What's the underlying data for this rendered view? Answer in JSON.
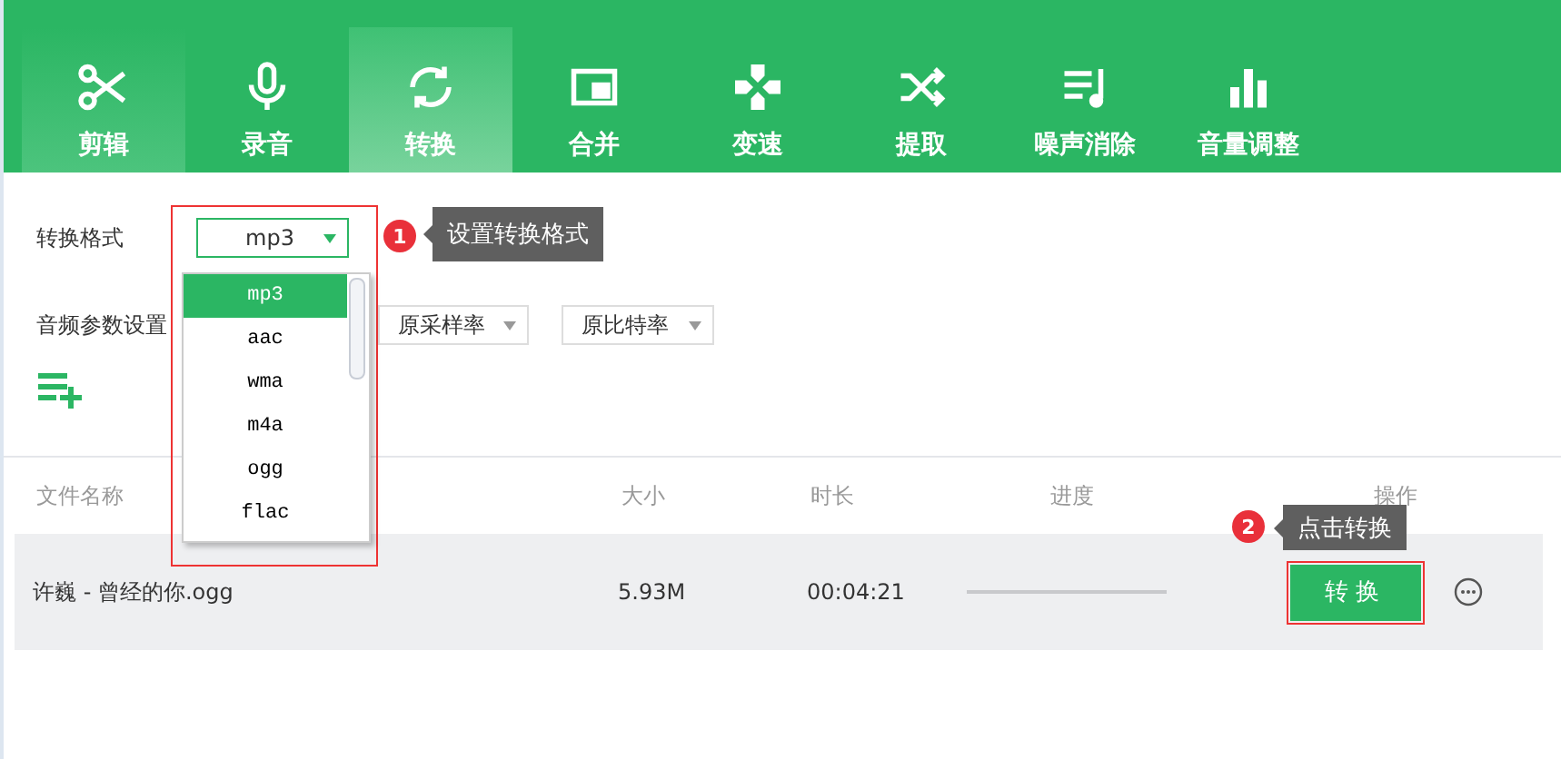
{
  "toolbar": {
    "tabs": [
      {
        "label": "剪辑",
        "selected": false,
        "hovered": true
      },
      {
        "label": "录音",
        "selected": false,
        "hovered": false
      },
      {
        "label": "转换",
        "selected": true,
        "hovered": false
      },
      {
        "label": "合并",
        "selected": false,
        "hovered": false
      },
      {
        "label": "变速",
        "selected": false,
        "hovered": false
      },
      {
        "label": "提取",
        "selected": false,
        "hovered": false
      },
      {
        "label": "噪声消除",
        "selected": false,
        "hovered": false
      },
      {
        "label": "音量调整",
        "selected": false,
        "hovered": false
      }
    ]
  },
  "format": {
    "label": "转换格式",
    "value": "mp3",
    "expanded": true,
    "options": [
      {
        "label": "mp3",
        "selected": true
      },
      {
        "label": "aac",
        "selected": false
      },
      {
        "label": "wma",
        "selected": false
      },
      {
        "label": "m4a",
        "selected": false
      },
      {
        "label": "ogg",
        "selected": false
      },
      {
        "label": "flac",
        "selected": false
      }
    ]
  },
  "audio_params": {
    "label": "音频参数设置",
    "sample_rate": "原采样率",
    "bit_rate": "原比特率"
  },
  "table": {
    "columns": [
      "文件名称",
      "大小",
      "时长",
      "进度",
      "操作"
    ],
    "rows": [
      {
        "name": "许巍 - 曾经的你.ogg",
        "size": "5.93M",
        "duration": "00:04:21",
        "level": 0,
        "action": "转换"
      }
    ]
  },
  "annotations": [
    {
      "number": "1",
      "text": "设置转换格式"
    },
    {
      "number": "2",
      "text": "点击转换"
    }
  ]
}
